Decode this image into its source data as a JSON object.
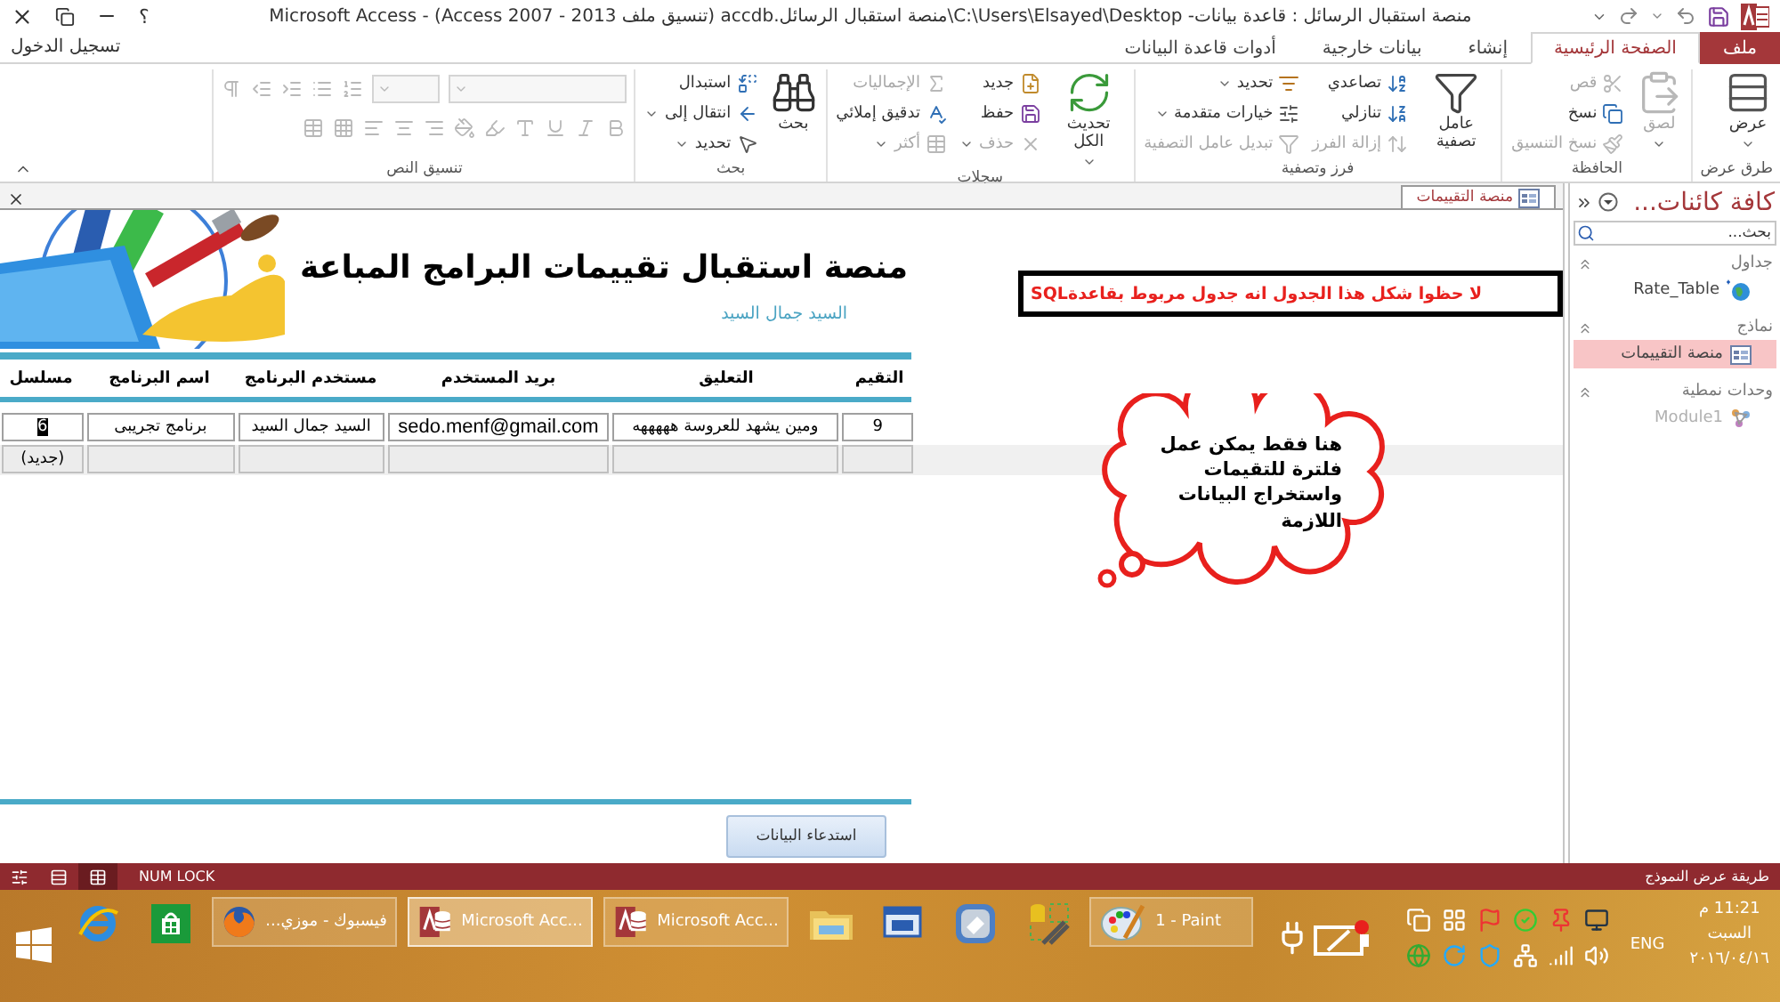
{
  "title_bar": {
    "title": "منصة استقبال الرسائل : قاعدة بيانات- C:\\Users\\Elsayed\\Desktop\\منصة استقبال الرسائل.accdb (تنسيق ملف Access 2007 - 2013) - Microsoft Access",
    "help": "؟"
  },
  "tabs": [
    {
      "label": "ملف",
      "kind": "file",
      "selected": false
    },
    {
      "label": "الصفحة الرئيسية",
      "kind": "tab",
      "selected": true
    },
    {
      "label": "إنشاء",
      "kind": "tab",
      "selected": false
    },
    {
      "label": "بيانات خارجية",
      "kind": "tab",
      "selected": false
    },
    {
      "label": "أدوات قاعدة البيانات",
      "kind": "tab",
      "selected": false
    }
  ],
  "sign_in": "تسجيل الدخول",
  "ribbon": {
    "groups": [
      {
        "label": "طرق عرض",
        "columns": [
          [
            {
              "kind": "large",
              "label": "عرض",
              "disabled": false,
              "dropdown": true
            }
          ]
        ]
      },
      {
        "label": "الحافظة",
        "columns": [
          [
            {
              "kind": "large",
              "label": "لصق",
              "disabled": true,
              "dropdown": true
            }
          ],
          [
            {
              "kind": "small",
              "label": "قص",
              "disabled": true,
              "dropdown": false
            },
            {
              "kind": "small",
              "label": "نسخ",
              "disabled": false,
              "dropdown": false
            },
            {
              "kind": "small",
              "label": "نسخ التنسيق",
              "disabled": true,
              "dropdown": false
            }
          ]
        ]
      },
      {
        "label": "فرز وتصفية",
        "columns": [
          [
            {
              "kind": "large",
              "label": "عامل تصفية",
              "disabled": false,
              "dropdown": false
            }
          ],
          [
            {
              "kind": "small",
              "label": "تصاعدي",
              "disabled": false,
              "dropdown": false
            },
            {
              "kind": "small",
              "label": "تنازلي",
              "disabled": false,
              "dropdown": false
            },
            {
              "kind": "small",
              "label": "إزالة الفرز",
              "disabled": true,
              "dropdown": false
            }
          ],
          [
            {
              "kind": "small",
              "label": "تحديد",
              "disabled": false,
              "dropdown": true
            },
            {
              "kind": "small",
              "label": "خيارات متقدمة",
              "disabled": false,
              "dropdown": true
            },
            {
              "kind": "small",
              "label": "تبديل عامل التصفية",
              "disabled": true,
              "dropdown": false
            }
          ]
        ]
      },
      {
        "label": "سجلات",
        "columns": [
          [
            {
              "kind": "large",
              "label": "تحديث الكل",
              "disabled": false,
              "dropdown": true
            }
          ],
          [
            {
              "kind": "small",
              "label": "جديد",
              "disabled": false,
              "dropdown": false
            },
            {
              "kind": "small",
              "label": "حفظ",
              "disabled": false,
              "dropdown": false
            },
            {
              "kind": "small",
              "label": "حذف",
              "disabled": true,
              "dropdown": true
            }
          ],
          [
            {
              "kind": "small",
              "label": "الإجماليات",
              "disabled": true,
              "dropdown": false
            },
            {
              "kind": "small",
              "label": "تدقيق إملائي",
              "disabled": false,
              "dropdown": false
            },
            {
              "kind": "small",
              "label": "أكثر",
              "disabled": true,
              "dropdown": true
            }
          ]
        ]
      },
      {
        "label": "بحث",
        "columns": [
          [
            {
              "kind": "large",
              "label": "بحث",
              "disabled": false,
              "dropdown": false
            }
          ],
          [
            {
              "kind": "small",
              "label": "استبدال",
              "disabled": false,
              "dropdown": false
            },
            {
              "kind": "small",
              "label": "انتقال إلى",
              "disabled": false,
              "dropdown": true
            },
            {
              "kind": "small",
              "label": "تحديد",
              "disabled": false,
              "dropdown": true
            }
          ]
        ]
      }
    ],
    "text_format": {
      "label": "تنسيق النص",
      "disabled": true
    }
  },
  "document": {
    "tab": {
      "label": "منصة التقييمات",
      "selected": true
    },
    "form": {
      "title": "منصة استقبال تقييمات البرامج المباعة",
      "subtitle": "السيد جمال السيد",
      "columns": [
        "التقيم",
        "التعليق",
        "بريد المستخدم",
        "مستخدم البرنامج",
        "اسم البرنامج",
        "مسلسل"
      ],
      "rows": [
        {
          "kind": "record",
          "cells": [
            {
              "text": "9",
              "selected": false
            },
            {
              "text": "ومين يشهد للعروسة هههههه",
              "selected": false
            },
            {
              "text": "sedo.menf@gmail.com",
              "selected": false
            },
            {
              "text": "السيد جمال السيد",
              "selected": false
            },
            {
              "text": "برنامج تجريبى",
              "selected": false
            },
            {
              "text": "6",
              "selected": true
            }
          ]
        },
        {
          "kind": "new",
          "label": "(جديد)"
        }
      ],
      "button": "استدعاء البيانات"
    }
  },
  "navigation_pane": {
    "title": "كافة كائنات...",
    "search": {
      "placeholder": "بحث..."
    },
    "groups": [
      {
        "label": "جداول",
        "items": [
          {
            "label": "Rate_Table",
            "kind": "linked_table",
            "selected": false,
            "disabled": false
          }
        ]
      },
      {
        "label": "نماذج",
        "items": [
          {
            "label": "منصة التقييمات",
            "kind": "form",
            "selected": true,
            "disabled": false
          }
        ]
      },
      {
        "label": "وحدات نمطية",
        "items": [
          {
            "label": "Module1",
            "kind": "module",
            "selected": false,
            "disabled": true
          }
        ]
      }
    ]
  },
  "annotation": "لا حظوا شكل هذا الجدول انه جدول مربوط بقاعدةSQL",
  "callout": "هنا فقط يمكن عمل فلترة للتقيمات واستخراج البيانات اللازمة",
  "status_bar": {
    "views": [
      {
        "selected": false
      },
      {
        "selected": false
      },
      {
        "selected": true
      }
    ],
    "indicator": "NUM LOCK",
    "mode": "طريقة عرض النموذج"
  },
  "taskbar": {
    "tray": {
      "time": "11:21 م",
      "day": "السبت",
      "date": "٢٠١٦/٠٤/١٦",
      "language": "ENG"
    },
    "items": [
      {
        "kind": "paint",
        "label": "1 - Paint",
        "selected": false
      },
      {
        "kind": "tools"
      },
      {
        "kind": "tile"
      },
      {
        "kind": "vb"
      },
      {
        "kind": "folder"
      },
      {
        "kind": "access",
        "label": "Microsoft Acc...",
        "selected": false
      },
      {
        "kind": "access",
        "label": "Microsoft Acc...",
        "selected": true
      },
      {
        "kind": "firefox",
        "label": "فيسبوك - موزي...",
        "selected": false
      },
      {
        "kind": "store"
      },
      {
        "kind": "browser"
      },
      {
        "kind": "start"
      }
    ]
  }
}
